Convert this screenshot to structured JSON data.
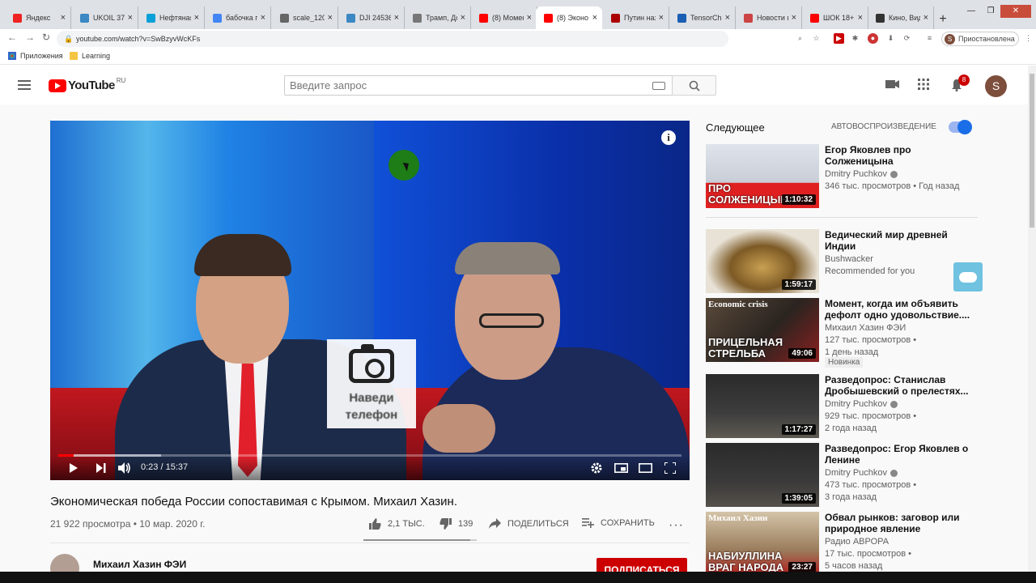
{
  "browser": {
    "tabs": [
      {
        "title": "Яндекс",
        "color": "#e22"
      },
      {
        "title": "UKOIL 37.8",
        "color": "#3b88c3"
      },
      {
        "title": "Нефтяная",
        "color": "#0aa0d8"
      },
      {
        "title": "бабочка п",
        "color": "#4285f4"
      },
      {
        "title": "scale_1200",
        "color": "#666"
      },
      {
        "title": "DJI 24536",
        "color": "#3b88c3"
      },
      {
        "title": "Трамп, До",
        "color": "#777"
      },
      {
        "title": "(8) Момен",
        "color": "#f00"
      },
      {
        "title": "(8) Эконо",
        "color": "#f00"
      },
      {
        "title": "Путин наз",
        "color": "#a00"
      },
      {
        "title": "TensorCha",
        "color": "#1a5fb4"
      },
      {
        "title": "Новости п",
        "color": "#c44"
      },
      {
        "title": "ШОК 18+",
        "color": "#f00"
      },
      {
        "title": "Кино, Вид",
        "color": "#333"
      }
    ],
    "active_tab_index": 8,
    "url": "youtube.com/watch?v=SwBzyvWcKFs",
    "profile_status": "Приостановлена",
    "profile_initial": "S",
    "bookmarks": [
      "Приложения",
      "Learning"
    ]
  },
  "header": {
    "logo_text": "YouTube",
    "logo_region": "RU",
    "search_placeholder": "Введите запрос",
    "notifications_count": "8",
    "avatar_initial": "S"
  },
  "player": {
    "current_time": "0:23",
    "duration": "15:37",
    "overlay_text": "Наведи телефон",
    "progress_fraction": 0.025
  },
  "video": {
    "title": "Экономическая победа России сопоставимая с Крымом. Михаил Хазин.",
    "views_date": "21 922 просмотра • 10 мар. 2020 г.",
    "likes": "2,1 ТЫС.",
    "dislikes": "139",
    "share_label": "ПОДЕЛИТЬСЯ",
    "save_label": "СОХРАНИТЬ",
    "channel": "Михаил Хазин ФЭИ",
    "subscribe_label": "ПОДПИСАТЬСЯ"
  },
  "sidebar": {
    "up_next": "Следующее",
    "autoplay_label": "АВТОВОСПРОИЗВЕДЕНИЕ",
    "autoplay_on": true,
    "recommendations": [
      {
        "title": "Егор Яковлев про Солженицына",
        "channel": "Dmitry Puchkov",
        "verified": true,
        "meta": "346 тыс. просмотров • Год назад",
        "meta2": "",
        "duration": "1:10:32",
        "badge": "",
        "thumb_caption": "ПРО СОЛЖЕНИЦЫНА"
      },
      {
        "title": "Ведический мир древней Индии",
        "channel": "Bushwacker",
        "verified": false,
        "meta": "Recommended for you",
        "meta2": "",
        "duration": "1:59:17",
        "badge": "",
        "thumb_caption": ""
      },
      {
        "title": "Момент, когда им объявить дефолт одно удовольствие....",
        "channel": "Михаил Хазин ФЭИ",
        "verified": false,
        "meta": "127 тыс. просмотров •",
        "meta2": "1 день назад",
        "duration": "49:06",
        "badge": "Новинка",
        "thumb_caption": "ПРИЦЕЛЬНАЯ СТРЕЛЬБА",
        "thumb_top": "Economic crisis"
      },
      {
        "title": "Разведопрос: Станислав Дробышевский о прелестях...",
        "channel": "Dmitry Puchkov",
        "verified": true,
        "meta": "929 тыс. просмотров •",
        "meta2": "2 года назад",
        "duration": "1:17:27",
        "badge": "",
        "thumb_caption": ""
      },
      {
        "title": "Разведопрос: Егор Яковлев о Ленине",
        "channel": "Dmitry Puchkov",
        "verified": true,
        "meta": "473 тыс. просмотров •",
        "meta2": "3 года назад",
        "duration": "1:39:05",
        "badge": "",
        "thumb_caption": ""
      },
      {
        "title": "Обвал рынков: заговор или природное явление (Михаил...",
        "channel": "Радио АВРОРА",
        "verified": false,
        "meta": "17 тыс. просмотров •",
        "meta2": "5 часов назад",
        "duration": "23:27",
        "badge": "",
        "thumb_caption": "НАБИУЛЛИНА ВРАГ НАРОДА",
        "thumb_top": "Михаил Хазин"
      }
    ]
  }
}
